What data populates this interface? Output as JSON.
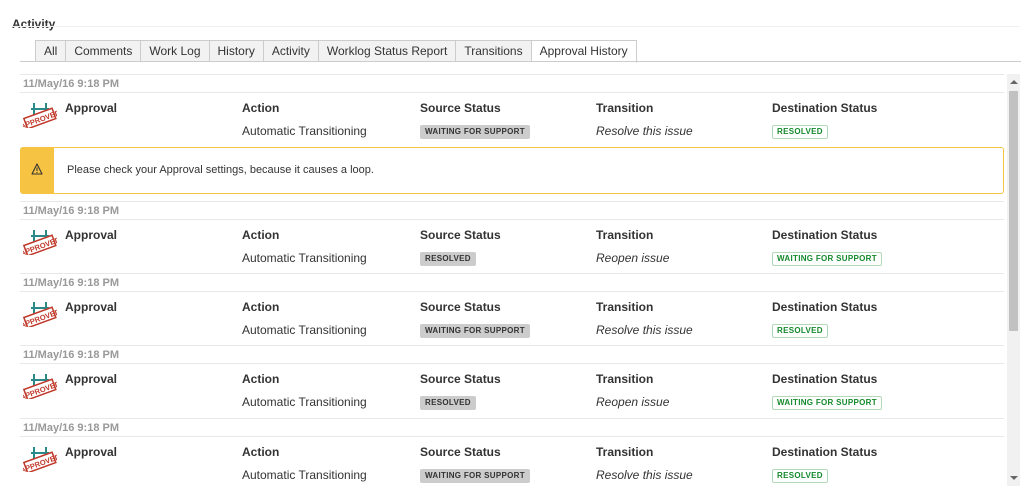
{
  "section_title": "Activity",
  "tabs": [
    "All",
    "Comments",
    "Work Log",
    "History",
    "Activity",
    "Worklog Status Report",
    "Transitions",
    "Approval History"
  ],
  "active_tab": "Approval History",
  "columns": {
    "approval": "Approval",
    "action": "Action",
    "source": "Source Status",
    "transition": "Transition",
    "destination": "Destination Status"
  },
  "stamp_text": "APPROVED",
  "entries": [
    {
      "date": "11/May/16 9:18 PM",
      "action": "Automatic Transitioning",
      "source_status": "WAITING FOR SUPPORT",
      "transition": "Resolve this issue",
      "destination_status": "RESOLVED"
    },
    {
      "date": "11/May/16 9:18 PM",
      "action": "Automatic Transitioning",
      "source_status": "RESOLVED",
      "transition": "Reopen issue",
      "destination_status": "WAITING FOR SUPPORT"
    },
    {
      "date": "11/May/16 9:18 PM",
      "action": "Automatic Transitioning",
      "source_status": "WAITING FOR SUPPORT",
      "transition": "Resolve this issue",
      "destination_status": "RESOLVED"
    },
    {
      "date": "11/May/16 9:18 PM",
      "action": "Automatic Transitioning",
      "source_status": "RESOLVED",
      "transition": "Reopen issue",
      "destination_status": "WAITING FOR SUPPORT"
    },
    {
      "date": "11/May/16 9:18 PM",
      "action": "Automatic Transitioning",
      "source_status": "WAITING FOR SUPPORT",
      "transition": "Resolve this issue",
      "destination_status": "RESOLVED"
    }
  ],
  "warning": {
    "icon": "warning-icon",
    "text": "Please check your Approval settings, because it causes a loop."
  },
  "colors": {
    "warning": "#f6c342",
    "status_green": "#14892c",
    "status_grey": "#cccccc",
    "stamp_red": "#c0392b"
  }
}
